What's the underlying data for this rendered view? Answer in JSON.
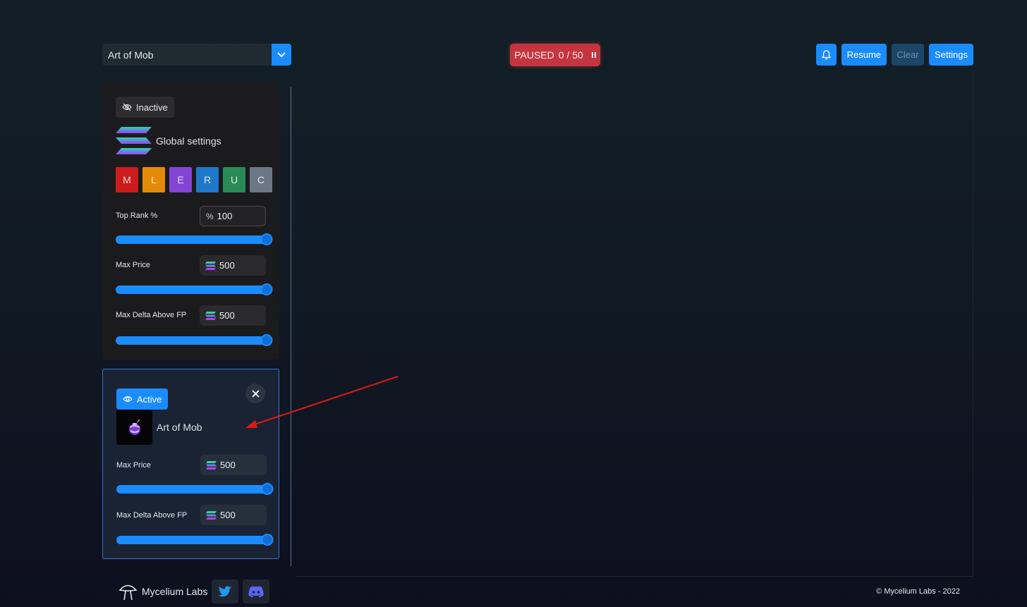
{
  "header": {
    "collection_select": {
      "value": "Art of Mob"
    },
    "status": {
      "state": "PAUSED",
      "progress": "0 / 50",
      "color": "#c4353f"
    },
    "actions": {
      "resume": "Resume",
      "clear": "Clear",
      "settings": "Settings"
    }
  },
  "global_settings": {
    "status_chip": "Inactive",
    "title": "Global settings",
    "rarities": [
      {
        "label": "M",
        "color": "#cc1c1c"
      },
      {
        "label": "L",
        "color": "#e38a06"
      },
      {
        "label": "E",
        "color": "#8344d6"
      },
      {
        "label": "R",
        "color": "#1f78c9"
      },
      {
        "label": "U",
        "color": "#2a8a57"
      },
      {
        "label": "C",
        "color": "#6b7784"
      }
    ],
    "fields": [
      {
        "label": "Top Rank %",
        "value": "100",
        "icon": "percent-icon",
        "slider": 1.0
      },
      {
        "label": "Max Price",
        "value": "500",
        "icon": "solana-icon",
        "slider": 1.0
      },
      {
        "label": "Max Delta Above FP",
        "value": "500",
        "icon": "solana-icon",
        "slider": 1.0
      }
    ]
  },
  "collection_card": {
    "status_chip": "Active",
    "title": "Art of Mob",
    "fields": [
      {
        "label": "Max Price",
        "value": "500",
        "icon": "solana-icon",
        "slider": 1.0
      },
      {
        "label": "Max Delta Above FP",
        "value": "500",
        "icon": "solana-icon",
        "slider": 1.0
      }
    ]
  },
  "footer": {
    "brand": "Mycelium Labs",
    "copyright": "© Mycelium Labs - 2022"
  },
  "colors": {
    "accent": "#1a8cff",
    "panel": "#1b1b1d",
    "annotation": "#e01818"
  }
}
